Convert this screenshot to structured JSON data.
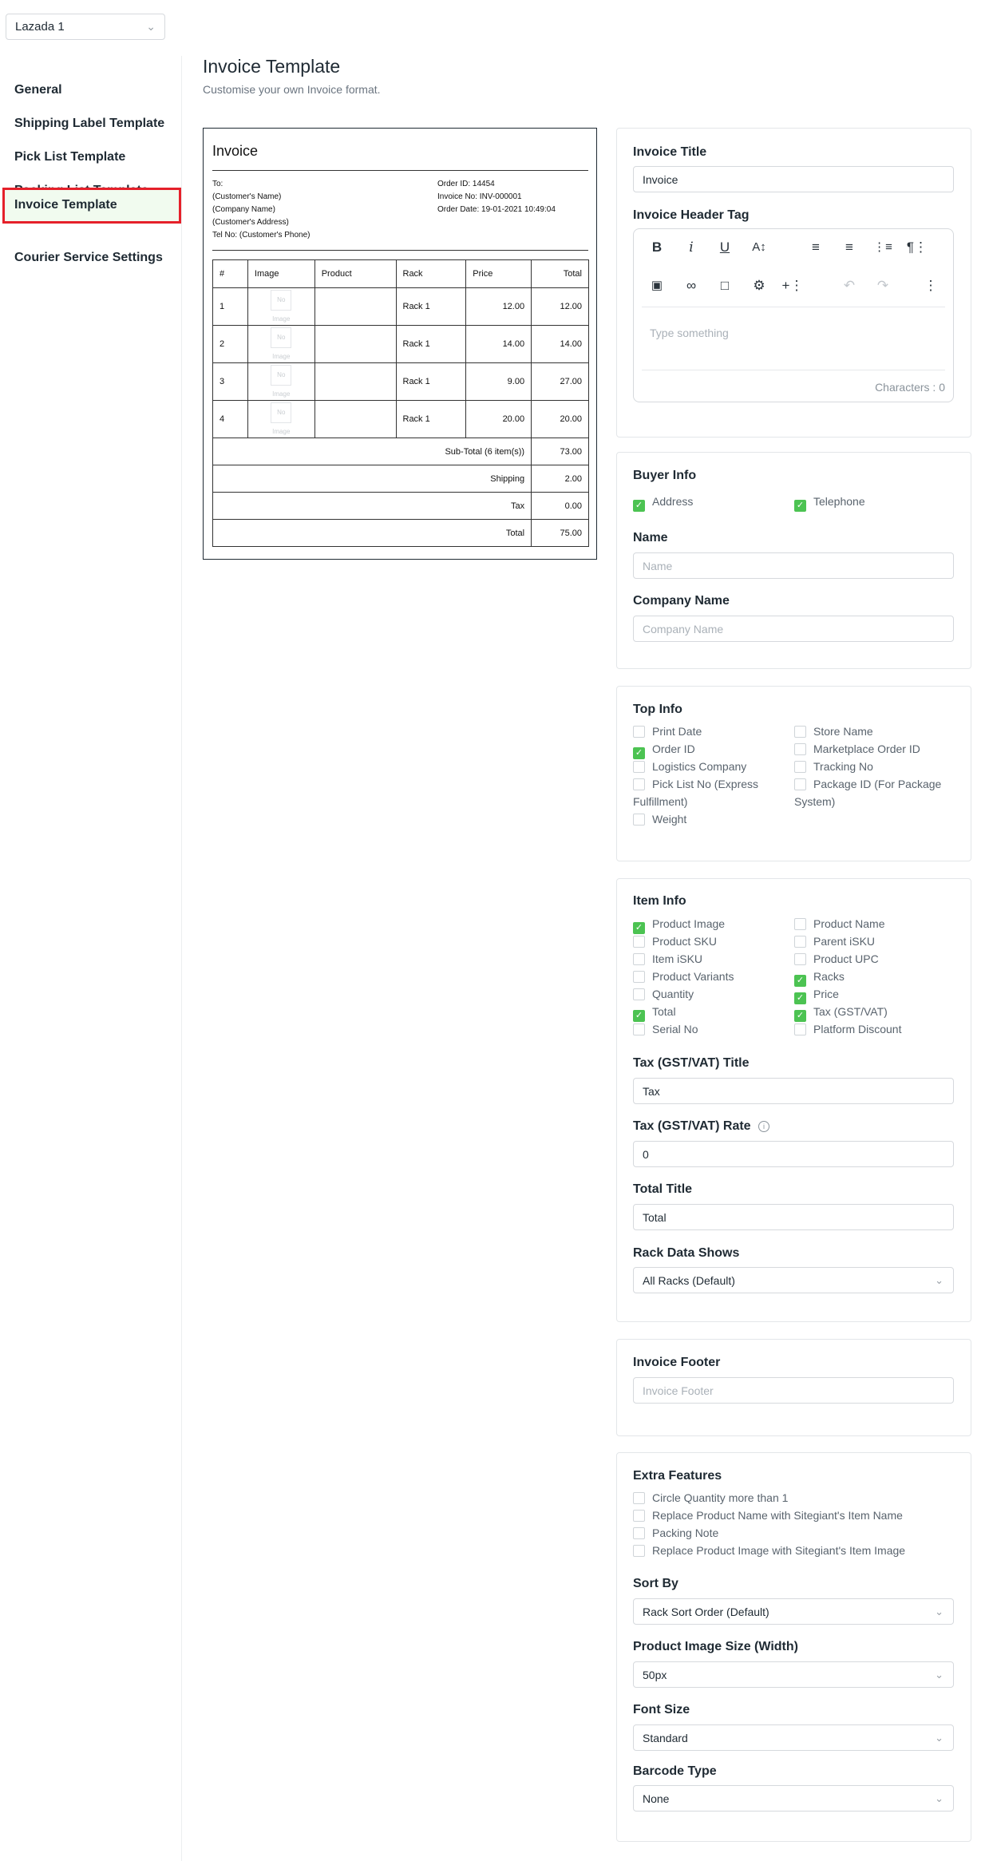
{
  "store_selector": {
    "value": "Lazada 1"
  },
  "sidebar": {
    "items": [
      {
        "label": "General"
      },
      {
        "label": "Shipping Label Template"
      },
      {
        "label": "Pick List Template"
      },
      {
        "label": "Packing List Template"
      },
      {
        "label": "Invoice Template"
      },
      {
        "label": "Courier Service Settings"
      }
    ]
  },
  "header": {
    "title": "Invoice Template",
    "subtitle": "Customise your own Invoice format."
  },
  "preview": {
    "title": "Invoice",
    "to_lines": [
      "To:",
      "(Customer's Name)",
      "(Company Name)",
      "(Customer's Address)",
      "Tel No: (Customer's Phone)"
    ],
    "order_lines": [
      "Order ID: 14454",
      "Invoice No: INV-000001",
      "Order Date: 19-01-2021 10:49:04"
    ],
    "columns": [
      "#",
      "Image",
      "Product",
      "Rack",
      "Price",
      "Total"
    ],
    "no_image_text": "No Image",
    "rows": [
      {
        "num": "1",
        "rack": "Rack 1",
        "price": "12.00",
        "total": "12.00"
      },
      {
        "num": "2",
        "rack": "Rack 1",
        "price": "14.00",
        "total": "14.00"
      },
      {
        "num": "3",
        "rack": "Rack 1",
        "price": "9.00",
        "total": "27.00"
      },
      {
        "num": "4",
        "rack": "Rack 1",
        "price": "20.00",
        "total": "20.00"
      }
    ],
    "summary": [
      {
        "label": "Sub-Total (6 item(s))",
        "value": "73.00"
      },
      {
        "label": "Shipping",
        "value": "2.00"
      },
      {
        "label": "Tax",
        "value": "0.00"
      },
      {
        "label": "Total",
        "value": "75.00"
      }
    ]
  },
  "invoice_title_panel": {
    "title_label": "Invoice Title",
    "title_value": "Invoice",
    "header_tag_label": "Invoice Header Tag",
    "editor_placeholder": "Type something",
    "characters": "Characters : 0"
  },
  "buyer_info": {
    "label": "Buyer Info",
    "options": [
      {
        "label": "Address",
        "checked": true
      },
      {
        "label": "Telephone",
        "checked": true
      }
    ],
    "name_label": "Name",
    "name_placeholder": "Name",
    "company_label": "Company Name",
    "company_placeholder": "Company Name"
  },
  "top_info": {
    "label": "Top Info",
    "left": [
      {
        "label": "Print Date",
        "checked": false
      },
      {
        "label": "Order ID",
        "checked": true
      },
      {
        "label": "Logistics Company",
        "checked": false
      },
      {
        "label": "Pick List No (Express",
        "label2": "Fulfillment)",
        "checked": false
      },
      {
        "label": "Weight",
        "checked": false
      }
    ],
    "right": [
      {
        "label": "Store Name",
        "checked": false
      },
      {
        "label": "Marketplace Order ID",
        "checked": false
      },
      {
        "label": "Tracking No",
        "checked": false
      },
      {
        "label": "Package ID (For Package",
        "label2": "System)",
        "checked": false
      }
    ]
  },
  "item_info": {
    "label": "Item Info",
    "left": [
      {
        "label": "Product Image",
        "checked": true
      },
      {
        "label": "Product SKU",
        "checked": false
      },
      {
        "label": "Item iSKU",
        "checked": false
      },
      {
        "label": "Product Variants",
        "checked": false
      },
      {
        "label": "Quantity",
        "checked": false
      },
      {
        "label": "Total",
        "checked": true
      },
      {
        "label": "Serial No",
        "checked": false
      }
    ],
    "right": [
      {
        "label": "Product Name",
        "checked": false
      },
      {
        "label": "Parent iSKU",
        "checked": false
      },
      {
        "label": "Product UPC",
        "checked": false
      },
      {
        "label": "Racks",
        "checked": true
      },
      {
        "label": "Price",
        "checked": true
      },
      {
        "label": "Tax (GST/VAT)",
        "checked": true
      },
      {
        "label": "Platform Discount",
        "checked": false
      }
    ],
    "tax_title_label": "Tax (GST/VAT) Title",
    "tax_title_value": "Tax",
    "tax_rate_label": "Tax (GST/VAT) Rate",
    "tax_rate_value": "0",
    "total_title_label": "Total Title",
    "total_title_value": "Total",
    "rack_label": "Rack Data Shows",
    "rack_value": "All Racks (Default)"
  },
  "footer_panel": {
    "label": "Invoice Footer",
    "placeholder": "Invoice Footer"
  },
  "extra_features": {
    "label": "Extra Features",
    "options": [
      {
        "label": "Circle Quantity more than 1",
        "checked": false
      },
      {
        "label": "Replace Product Name with Sitegiant's Item Name",
        "checked": false
      },
      {
        "label": "Packing Note",
        "checked": false
      },
      {
        "label": "Replace Product Image with Sitegiant's Item Image",
        "checked": false
      }
    ],
    "sort_label": "Sort By",
    "sort_value": "Rack Sort Order (Default)",
    "image_size_label": "Product Image Size (Width)",
    "image_size_value": "50px",
    "font_size_label": "Font Size",
    "font_size_value": "Standard",
    "barcode_label": "Barcode Type",
    "barcode_value": "None"
  },
  "colors": {
    "active_border": "#e5202a",
    "active_bg": "#f1fbef",
    "check_green": "#4cc352"
  }
}
